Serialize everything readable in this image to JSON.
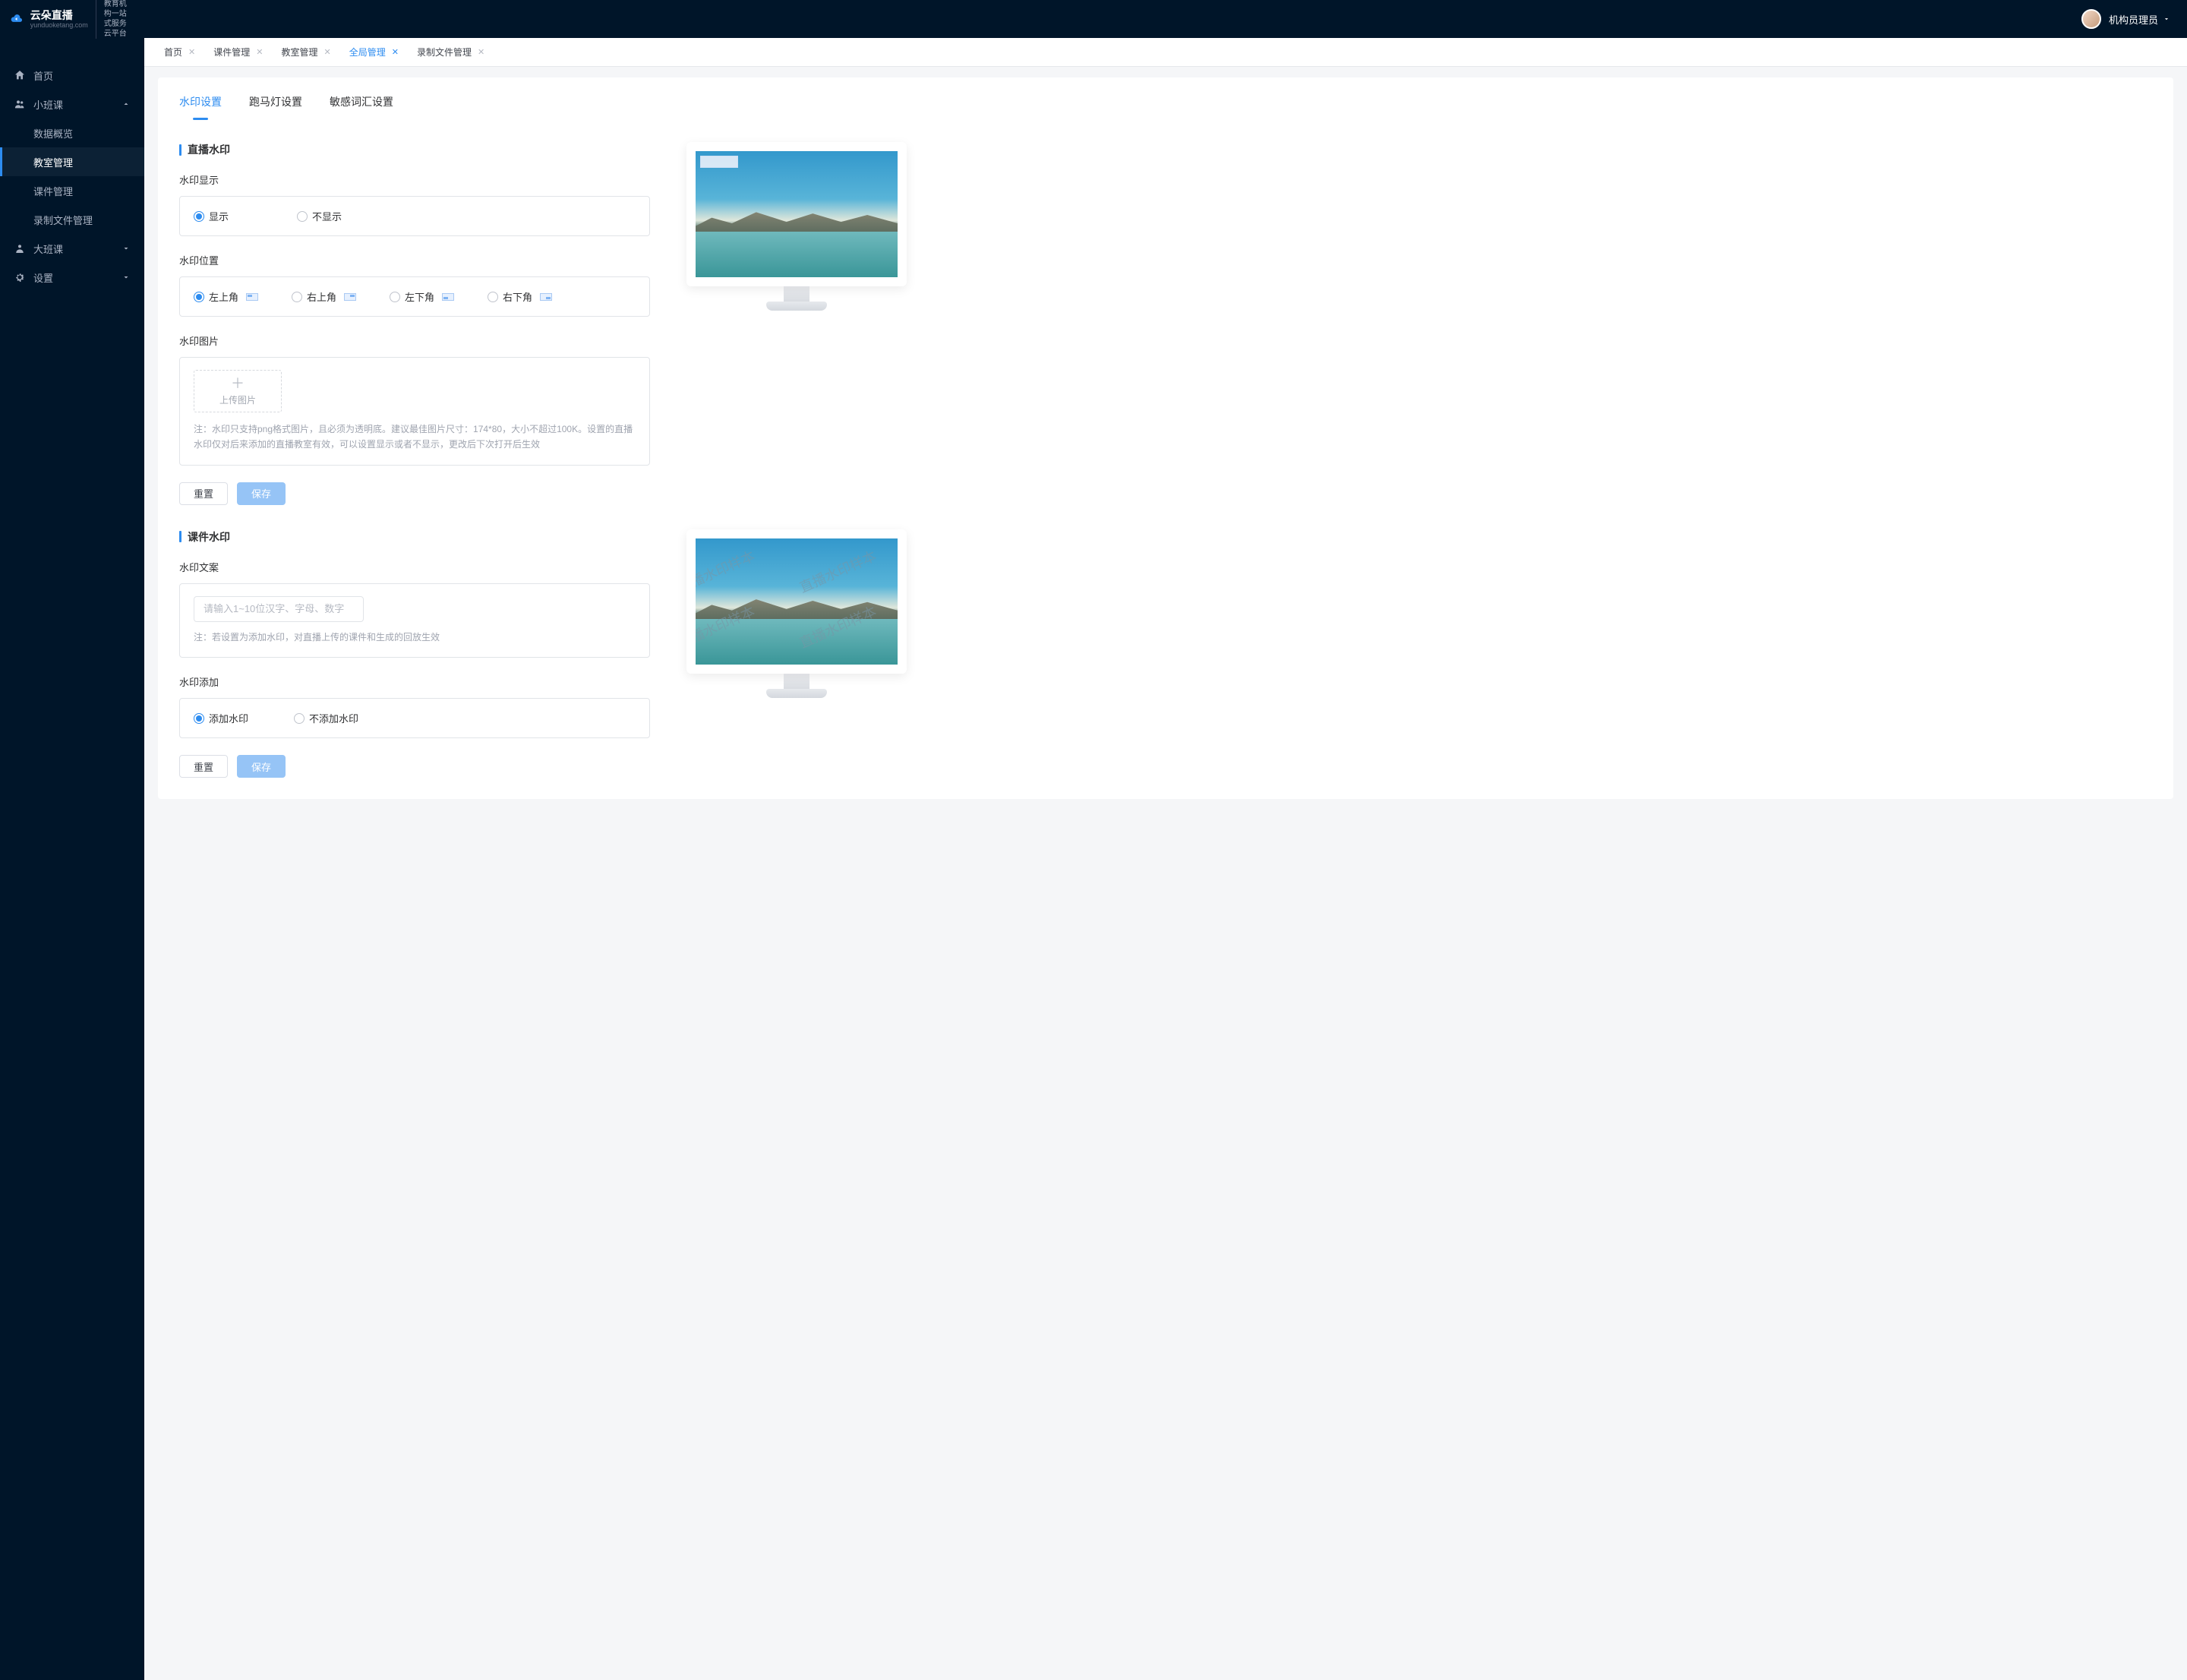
{
  "brand": {
    "name": "云朵直播",
    "domain": "yunduoketang.com",
    "tagline_l1": "教育机构一站",
    "tagline_l2": "式服务云平台"
  },
  "user": {
    "name": "机构员理员"
  },
  "nav": {
    "home": "首页",
    "small_class": "小班课",
    "small_sub": {
      "data": "数据概览",
      "classroom": "教室管理",
      "courseware": "课件管理",
      "recording": "录制文件管理"
    },
    "big_class": "大班课",
    "settings": "设置"
  },
  "tabs": [
    {
      "label": "首页"
    },
    {
      "label": "课件管理"
    },
    {
      "label": "教室管理"
    },
    {
      "label": "全局管理",
      "active": true
    },
    {
      "label": "录制文件管理"
    }
  ],
  "sub_tabs": {
    "watermark": "水印设置",
    "marquee": "跑马灯设置",
    "sensitive": "敏感词汇设置"
  },
  "sections": {
    "live": {
      "title": "直播水印",
      "display_label": "水印显示",
      "show": "显示",
      "hide": "不显示",
      "position_label": "水印位置",
      "tl": "左上角",
      "tr": "右上角",
      "bl": "左下角",
      "br": "右下角",
      "image_label": "水印图片",
      "upload": "上传图片",
      "note": "注：水印只支持png格式图片，且必须为透明底。建议最佳图片尺寸：174*80，大小不超过100K。设置的直播水印仅对后来添加的直播教室有效，可以设置显示或者不显示，更改后下次打开后生效",
      "reset": "重置",
      "save": "保存"
    },
    "courseware": {
      "title": "课件水印",
      "text_label": "水印文案",
      "placeholder": "请输入1~10位汉字、字母、数字",
      "note": "注：若设置为添加水印，对直播上传的课件和生成的回放生效",
      "add_label": "水印添加",
      "add_on": "添加水印",
      "add_off": "不添加水印",
      "reset": "重置",
      "save": "保存",
      "sample_text": "直播水印样本"
    }
  }
}
